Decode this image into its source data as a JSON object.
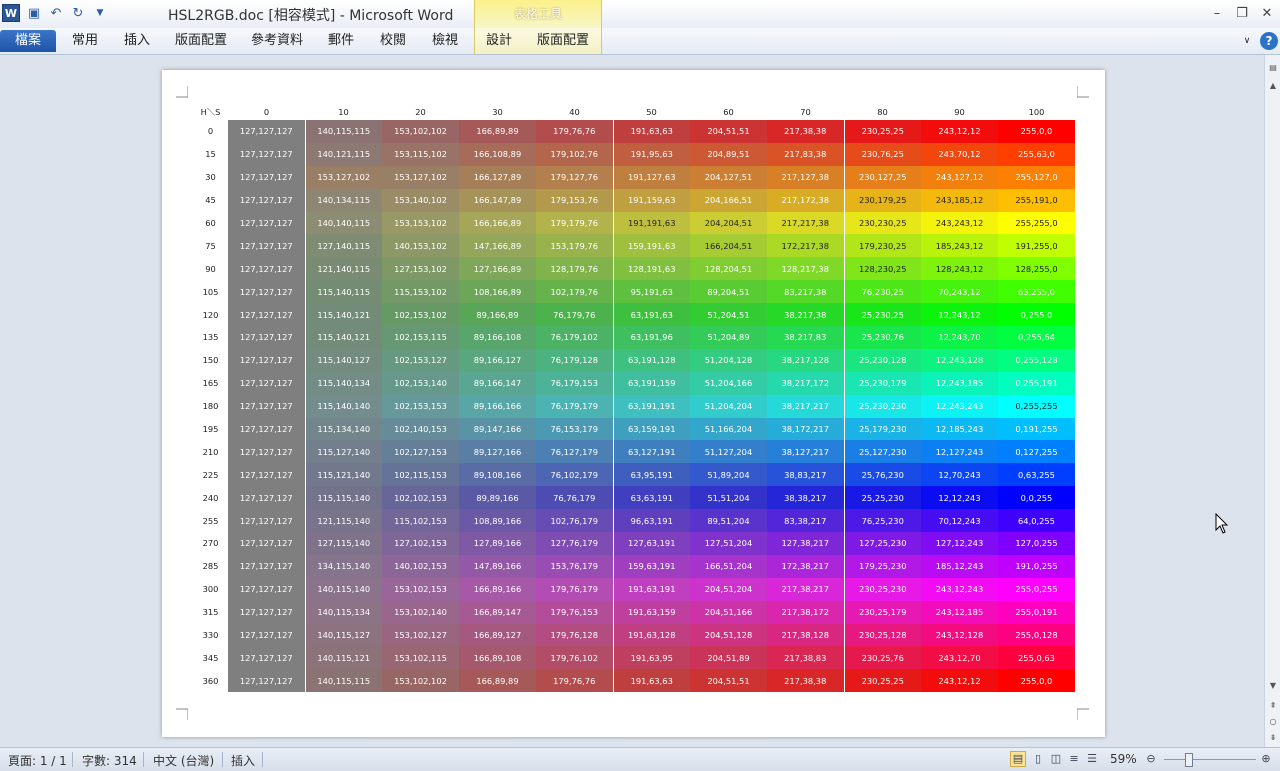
{
  "window": {
    "title": "HSL2RGB.doc [相容模式] - Microsoft Word",
    "context_tab_group": "表格工具"
  },
  "qat": {
    "save": "save-icon",
    "undo": "undo-icon",
    "redo": "redo-icon"
  },
  "ribbon": {
    "file_tab": "檔案",
    "tabs": [
      "常用",
      "插入",
      "版面配置",
      "參考資料",
      "郵件",
      "校閱",
      "檢視"
    ],
    "context_tabs": [
      "設計",
      "版面配置"
    ]
  },
  "table": {
    "corner": "H＼S",
    "s_headers": [
      "0",
      "10",
      "20",
      "30",
      "40",
      "50",
      "60",
      "70",
      "80",
      "90",
      "100"
    ],
    "h_values": [
      "0",
      "15",
      "30",
      "45",
      "60",
      "75",
      "90",
      "105",
      "120",
      "135",
      "150",
      "165",
      "180",
      "195",
      "210",
      "225",
      "240",
      "255",
      "270",
      "285",
      "300",
      "315",
      "330",
      "345",
      "360"
    ],
    "rows": [
      [
        "127,127,127",
        "140,115,115",
        "153,102,102",
        "166,89,89",
        "179,76,76",
        "191,63,63",
        "204,51,51",
        "217,38,38",
        "230,25,25",
        "243,12,12",
        "255,0,0"
      ],
      [
        "127,127,127",
        "140,121,115",
        "153,115,102",
        "166,108,89",
        "179,102,76",
        "191,95,63",
        "204,89,51",
        "217,83,38",
        "230,76,25",
        "243,70,12",
        "255,63,0"
      ],
      [
        "127,127,127",
        "153,127,102",
        "153,127,102",
        "166,127,89",
        "179,127,76",
        "191,127,63",
        "204,127,51",
        "217,127,38",
        "230,127,25",
        "243,127,12",
        "255,127,0"
      ],
      [
        "127,127,127",
        "140,134,115",
        "153,140,102",
        "166,147,89",
        "179,153,76",
        "191,159,63",
        "204,166,51",
        "217,172,38",
        "230,179,25",
        "243,185,12",
        "255,191,0"
      ],
      [
        "127,127,127",
        "140,140,115",
        "153,153,102",
        "166,166,89",
        "179,179,76",
        "191,191,63",
        "204,204,51",
        "217,217,38",
        "230,230,25",
        "243,243,12",
        "255,255,0"
      ],
      [
        "127,127,127",
        "127,140,115",
        "140,153,102",
        "147,166,89",
        "153,179,76",
        "159,191,63",
        "166,204,51",
        "172,217,38",
        "179,230,25",
        "185,243,12",
        "191,255,0"
      ],
      [
        "127,127,127",
        "121,140,115",
        "127,153,102",
        "127,166,89",
        "128,179,76",
        "128,191,63",
        "128,204,51",
        "128,217,38",
        "128,230,25",
        "128,243,12",
        "128,255,0"
      ],
      [
        "127,127,127",
        "115,140,115",
        "115,153,102",
        "108,166,89",
        "102,179,76",
        "95,191,63",
        "89,204,51",
        "83,217,38",
        "76,230,25",
        "70,243,12",
        "63,255,0"
      ],
      [
        "127,127,127",
        "115,140,121",
        "102,153,102",
        "89,166,89",
        "76,179,76",
        "63,191,63",
        "51,204,51",
        "38,217,38",
        "25,230,25",
        "12,243,12",
        "0,255,0"
      ],
      [
        "127,127,127",
        "115,140,121",
        "102,153,115",
        "89,166,108",
        "76,179,102",
        "63,191,96",
        "51,204,89",
        "38,217,83",
        "25,230,76",
        "12,243,70",
        "0,255,64"
      ],
      [
        "127,127,127",
        "115,140,127",
        "102,153,127",
        "89,166,127",
        "76,179,128",
        "63,191,128",
        "51,204,128",
        "38,217,128",
        "25,230,128",
        "12,243,128",
        "0,255,128"
      ],
      [
        "127,127,127",
        "115,140,134",
        "102,153,140",
        "89,166,147",
        "76,179,153",
        "63,191,159",
        "51,204,166",
        "38,217,172",
        "25,230,179",
        "12,243,185",
        "0,255,191"
      ],
      [
        "127,127,127",
        "115,140,140",
        "102,153,153",
        "89,166,166",
        "76,179,179",
        "63,191,191",
        "51,204,204",
        "38,217,217",
        "25,230,230",
        "12,243,243",
        "0,255,255"
      ],
      [
        "127,127,127",
        "115,134,140",
        "102,140,153",
        "89,147,166",
        "76,153,179",
        "63,159,191",
        "51,166,204",
        "38,172,217",
        "25,179,230",
        "12,185,243",
        "0,191,255"
      ],
      [
        "127,127,127",
        "115,127,140",
        "102,127,153",
        "89,127,166",
        "76,127,179",
        "63,127,191",
        "51,127,204",
        "38,127,217",
        "25,127,230",
        "12,127,243",
        "0,127,255"
      ],
      [
        "127,127,127",
        "115,121,140",
        "102,115,153",
        "89,108,166",
        "76,102,179",
        "63,95,191",
        "51,89,204",
        "38,83,217",
        "25,76,230",
        "12,70,243",
        "0,63,255"
      ],
      [
        "127,127,127",
        "115,115,140",
        "102,102,153",
        "89,89,166",
        "76,76,179",
        "63,63,191",
        "51,51,204",
        "38,38,217",
        "25,25,230",
        "12,12,243",
        "0,0,255"
      ],
      [
        "127,127,127",
        "121,115,140",
        "115,102,153",
        "108,89,166",
        "102,76,179",
        "96,63,191",
        "89,51,204",
        "83,38,217",
        "76,25,230",
        "70,12,243",
        "64,0,255"
      ],
      [
        "127,127,127",
        "127,115,140",
        "127,102,153",
        "127,89,166",
        "127,76,179",
        "127,63,191",
        "127,51,204",
        "127,38,217",
        "127,25,230",
        "127,12,243",
        "127,0,255"
      ],
      [
        "127,127,127",
        "134,115,140",
        "140,102,153",
        "147,89,166",
        "153,76,179",
        "159,63,191",
        "166,51,204",
        "172,38,217",
        "179,25,230",
        "185,12,243",
        "191,0,255"
      ],
      [
        "127,127,127",
        "140,115,140",
        "153,102,153",
        "166,89,166",
        "179,76,179",
        "191,63,191",
        "204,51,204",
        "217,38,217",
        "230,25,230",
        "243,12,243",
        "255,0,255"
      ],
      [
        "127,127,127",
        "140,115,134",
        "153,102,140",
        "166,89,147",
        "179,76,153",
        "191,63,159",
        "204,51,166",
        "217,38,172",
        "230,25,179",
        "243,12,185",
        "255,0,191"
      ],
      [
        "127,127,127",
        "140,115,127",
        "153,102,127",
        "166,89,127",
        "179,76,128",
        "191,63,128",
        "204,51,128",
        "217,38,128",
        "230,25,128",
        "243,12,128",
        "255,0,128"
      ],
      [
        "127,127,127",
        "140,115,121",
        "153,102,115",
        "166,89,108",
        "179,76,102",
        "191,63,95",
        "204,51,89",
        "217,38,83",
        "230,25,76",
        "243,12,70",
        "255,0,63"
      ],
      [
        "127,127,127",
        "140,115,115",
        "153,102,102",
        "166,89,89",
        "179,76,76",
        "191,63,63",
        "204,51,51",
        "217,38,38",
        "230,25,25",
        "243,12,12",
        "255,0,0"
      ]
    ]
  },
  "status": {
    "page": "頁面: 1 / 1",
    "words": "字數: 314",
    "language": "中文 (台灣)",
    "mode": "插入",
    "zoom": "59%"
  }
}
